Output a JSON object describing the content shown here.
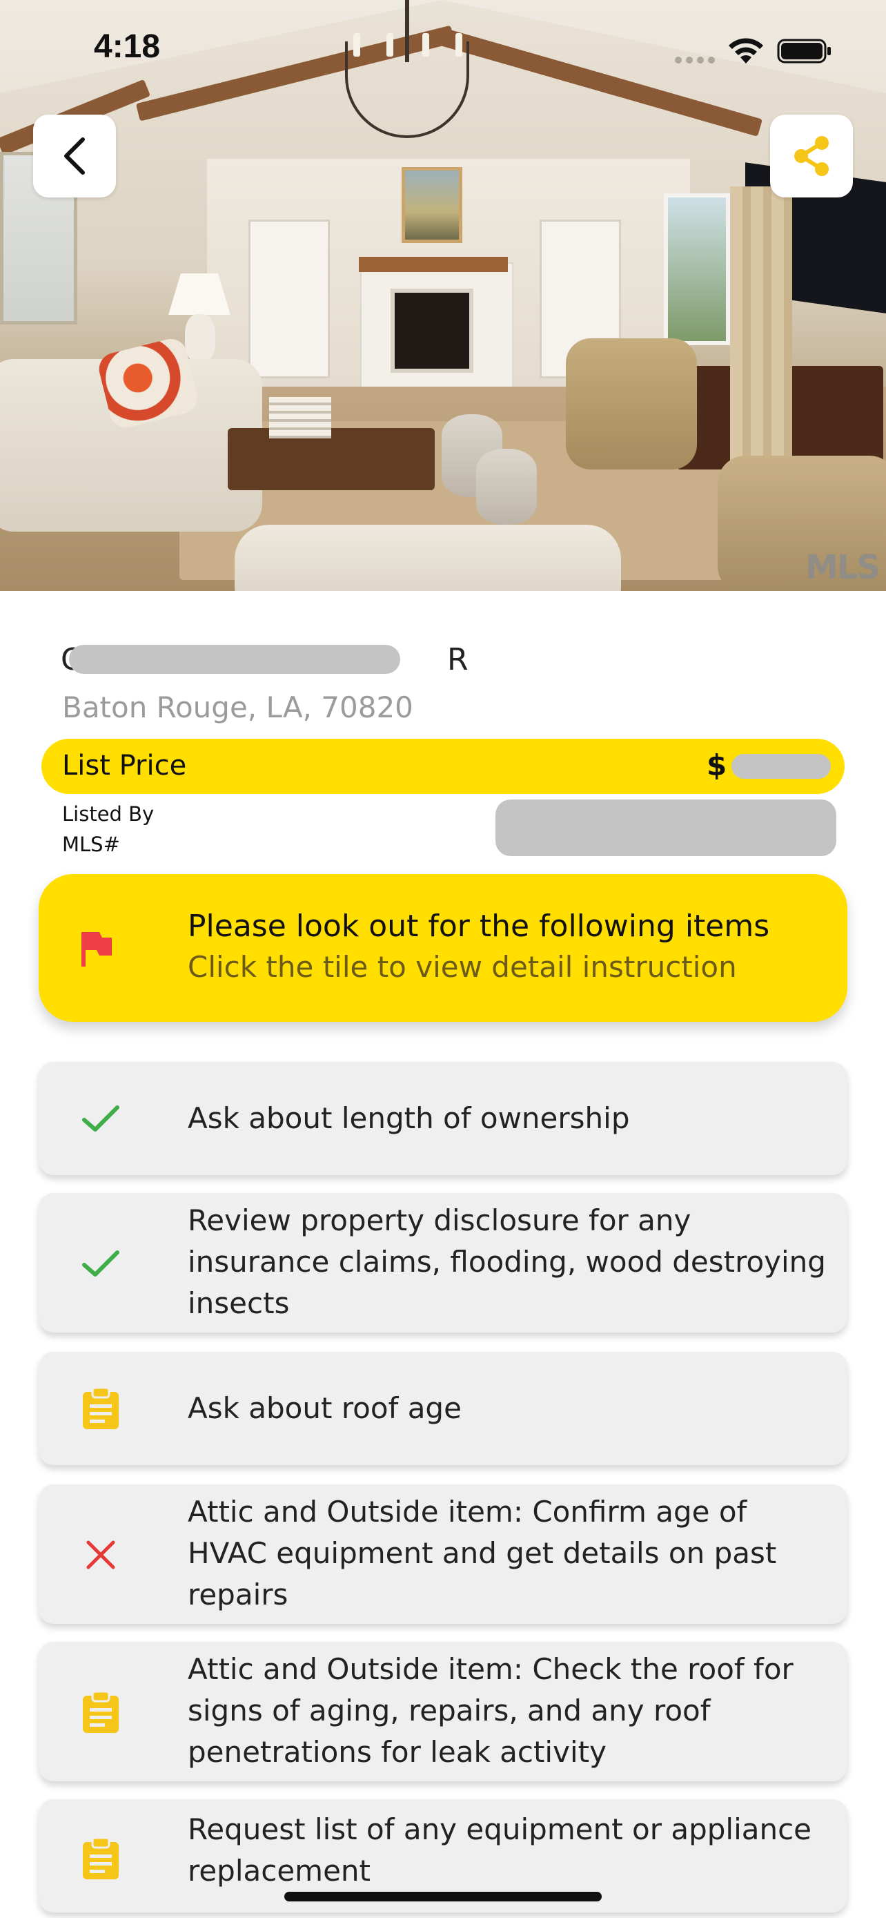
{
  "status_bar": {
    "time": "4:18"
  },
  "hero": {
    "watermark": "MLS"
  },
  "property": {
    "address_line1_start": "C",
    "address_line1_end": "R",
    "address_city": "Baton Rouge, LA, 70820",
    "price_label": "List Price",
    "price_prefix": "$",
    "listed_by_label": "Listed By",
    "mls_label": "MLS#"
  },
  "alert": {
    "title": "Please look out for the following items",
    "subtitle": "Click the tile to view detail instruction"
  },
  "tasks": [
    {
      "text": "Ask about length of ownership",
      "status": "done"
    },
    {
      "text": "Review property disclosure for any insurance claims, flooding, wood destroying insects",
      "status": "done"
    },
    {
      "text": "Ask about roof age",
      "status": "pending"
    },
    {
      "text": "Attic and Outside item: Confirm age of HVAC equipment and get details on past repairs",
      "status": "failed"
    },
    {
      "text": "Attic and Outside item: Check the roof for signs of aging, repairs, and any roof penetrations for leak activity",
      "status": "pending"
    },
    {
      "text": "Request list of any equipment or appliance replacement",
      "status": "pending"
    }
  ],
  "colors": {
    "accent_yellow": "#ffde00",
    "check_green": "#3fae49",
    "cross_red": "#e53935",
    "clipboard_yellow": "#f5c518",
    "flag_red": "#ef3d46"
  }
}
